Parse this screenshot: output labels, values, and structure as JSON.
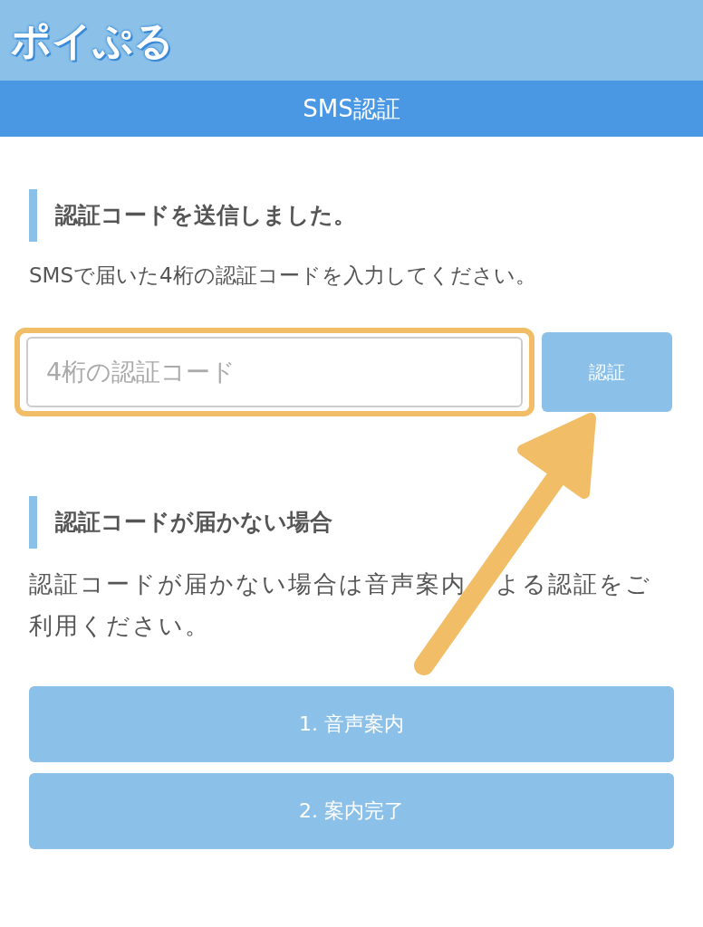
{
  "header": {
    "logo": "ポイぷる"
  },
  "title_bar": {
    "title": "SMS認証"
  },
  "sections": [
    {
      "heading": "認証コードを送信しました。",
      "text": "SMSで届いた4桁の認証コードを入力してください。",
      "field": {
        "placeholder": "4桁の認証コード",
        "highlighted": true
      },
      "button": "認証"
    },
    {
      "heading": "認証コードが届かない場合",
      "text_before_arrow": "認証コードが届かない場合は音声案内",
      "text_after_arrow": "よる認証をご",
      "text_line_2": "利用ください。",
      "buttons": [
        "1. 音声案内",
        "2. 案内完了"
      ]
    }
  ],
  "annotation": {
    "kind": "arrow"
  }
}
